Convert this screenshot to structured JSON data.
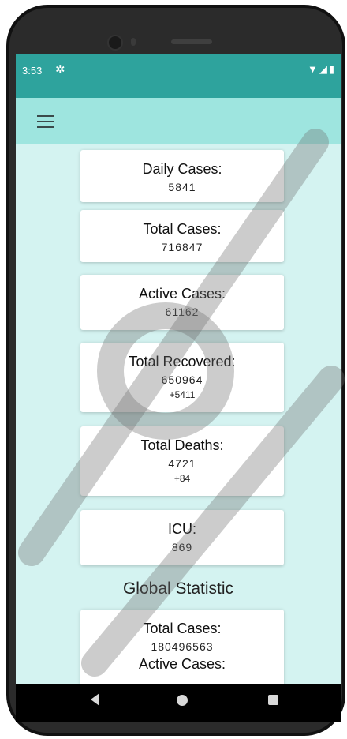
{
  "statusbar": {
    "time": "3:53"
  },
  "local_stats": [
    {
      "title": "Daily Cases:",
      "value": "5841"
    },
    {
      "title": "Total Cases:",
      "value": "716847"
    },
    {
      "title": "Active Cases:",
      "value": "61162"
    },
    {
      "title": "Total Recovered:",
      "value": "650964",
      "delta": "+5411"
    },
    {
      "title": "Total Deaths:",
      "value": "4721",
      "delta": "+84"
    },
    {
      "title": "ICU:",
      "value": "869"
    }
  ],
  "global": {
    "section_title": "Global Statistic",
    "total_cases_title": "Total Cases:",
    "total_cases_value": "180496563",
    "active_cases_title": "Active Cases:"
  },
  "icons": {
    "menu": "hamburger-menu-icon",
    "settings": "gear-icon",
    "wifi": "wifi-icon",
    "signal": "signal-icon",
    "battery": "battery-icon",
    "back": "back-icon",
    "home": "home-icon",
    "recents": "recents-icon"
  },
  "colors": {
    "statusbar": "#2ea39d",
    "appbar": "#9ee5df",
    "background": "#d4f3f1",
    "card": "#ffffff"
  }
}
